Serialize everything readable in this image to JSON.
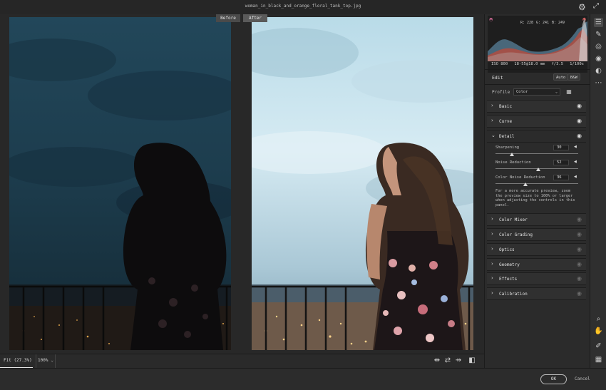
{
  "window": {
    "filename": "woman_in_black_and_orange_floral_tank_top.jpg"
  },
  "compare": {
    "before_label": "Before",
    "after_label": "After"
  },
  "histogram": {
    "r": "R: 228",
    "g": "G: 241",
    "b": "B: 249",
    "iso": "ISO 800",
    "lens": "18-55@18.0 mm",
    "aperture": "f/3.5",
    "shutter": "1/100s"
  },
  "edit": {
    "title": "Edit",
    "auto_label": "Auto",
    "bw_label": "B&W"
  },
  "profile": {
    "label": "Profile",
    "value": "Color"
  },
  "sections": {
    "basic": "Basic",
    "curve": "Curve",
    "detail": "Detail",
    "color_mixer": "Color Mixer",
    "color_grading": "Color Grading",
    "optics": "Optics",
    "geometry": "Geometry",
    "effects": "Effects",
    "calibration": "Calibration"
  },
  "detail": {
    "sharpening": {
      "label": "Sharpening",
      "value": "30",
      "level": 0.2
    },
    "noise_reduction": {
      "label": "Noise Reduction",
      "value": "52",
      "level": 0.52
    },
    "color_noise_reduction": {
      "label": "Color Noise Reduction",
      "value": "36",
      "level": 0.36
    },
    "hint": "For a more accurate preview, zoom the preview size to 100% or larger when adjusting the controls in this panel."
  },
  "zoom": {
    "fit": "Fit (27.3%)",
    "level": "100%"
  },
  "footer": {
    "ok_label": "OK",
    "cancel_label": "Cancel"
  },
  "colors": {
    "accent": "#e6e6e6",
    "panel": "#2b2b2b",
    "clip_warning": "#e070a0"
  },
  "icons": {
    "settings": "gear-icon",
    "fullscreen": "fullscreen-icon",
    "edit": "sliders-icon",
    "heal": "brush-icon",
    "mask": "mask-icon",
    "redeye": "eye-icon",
    "presets": "presets-icon",
    "more": "more-icon",
    "zoom": "zoom-icon",
    "hand": "hand-icon",
    "sampler": "eyedropper-icon",
    "grid": "grid-icon"
  }
}
